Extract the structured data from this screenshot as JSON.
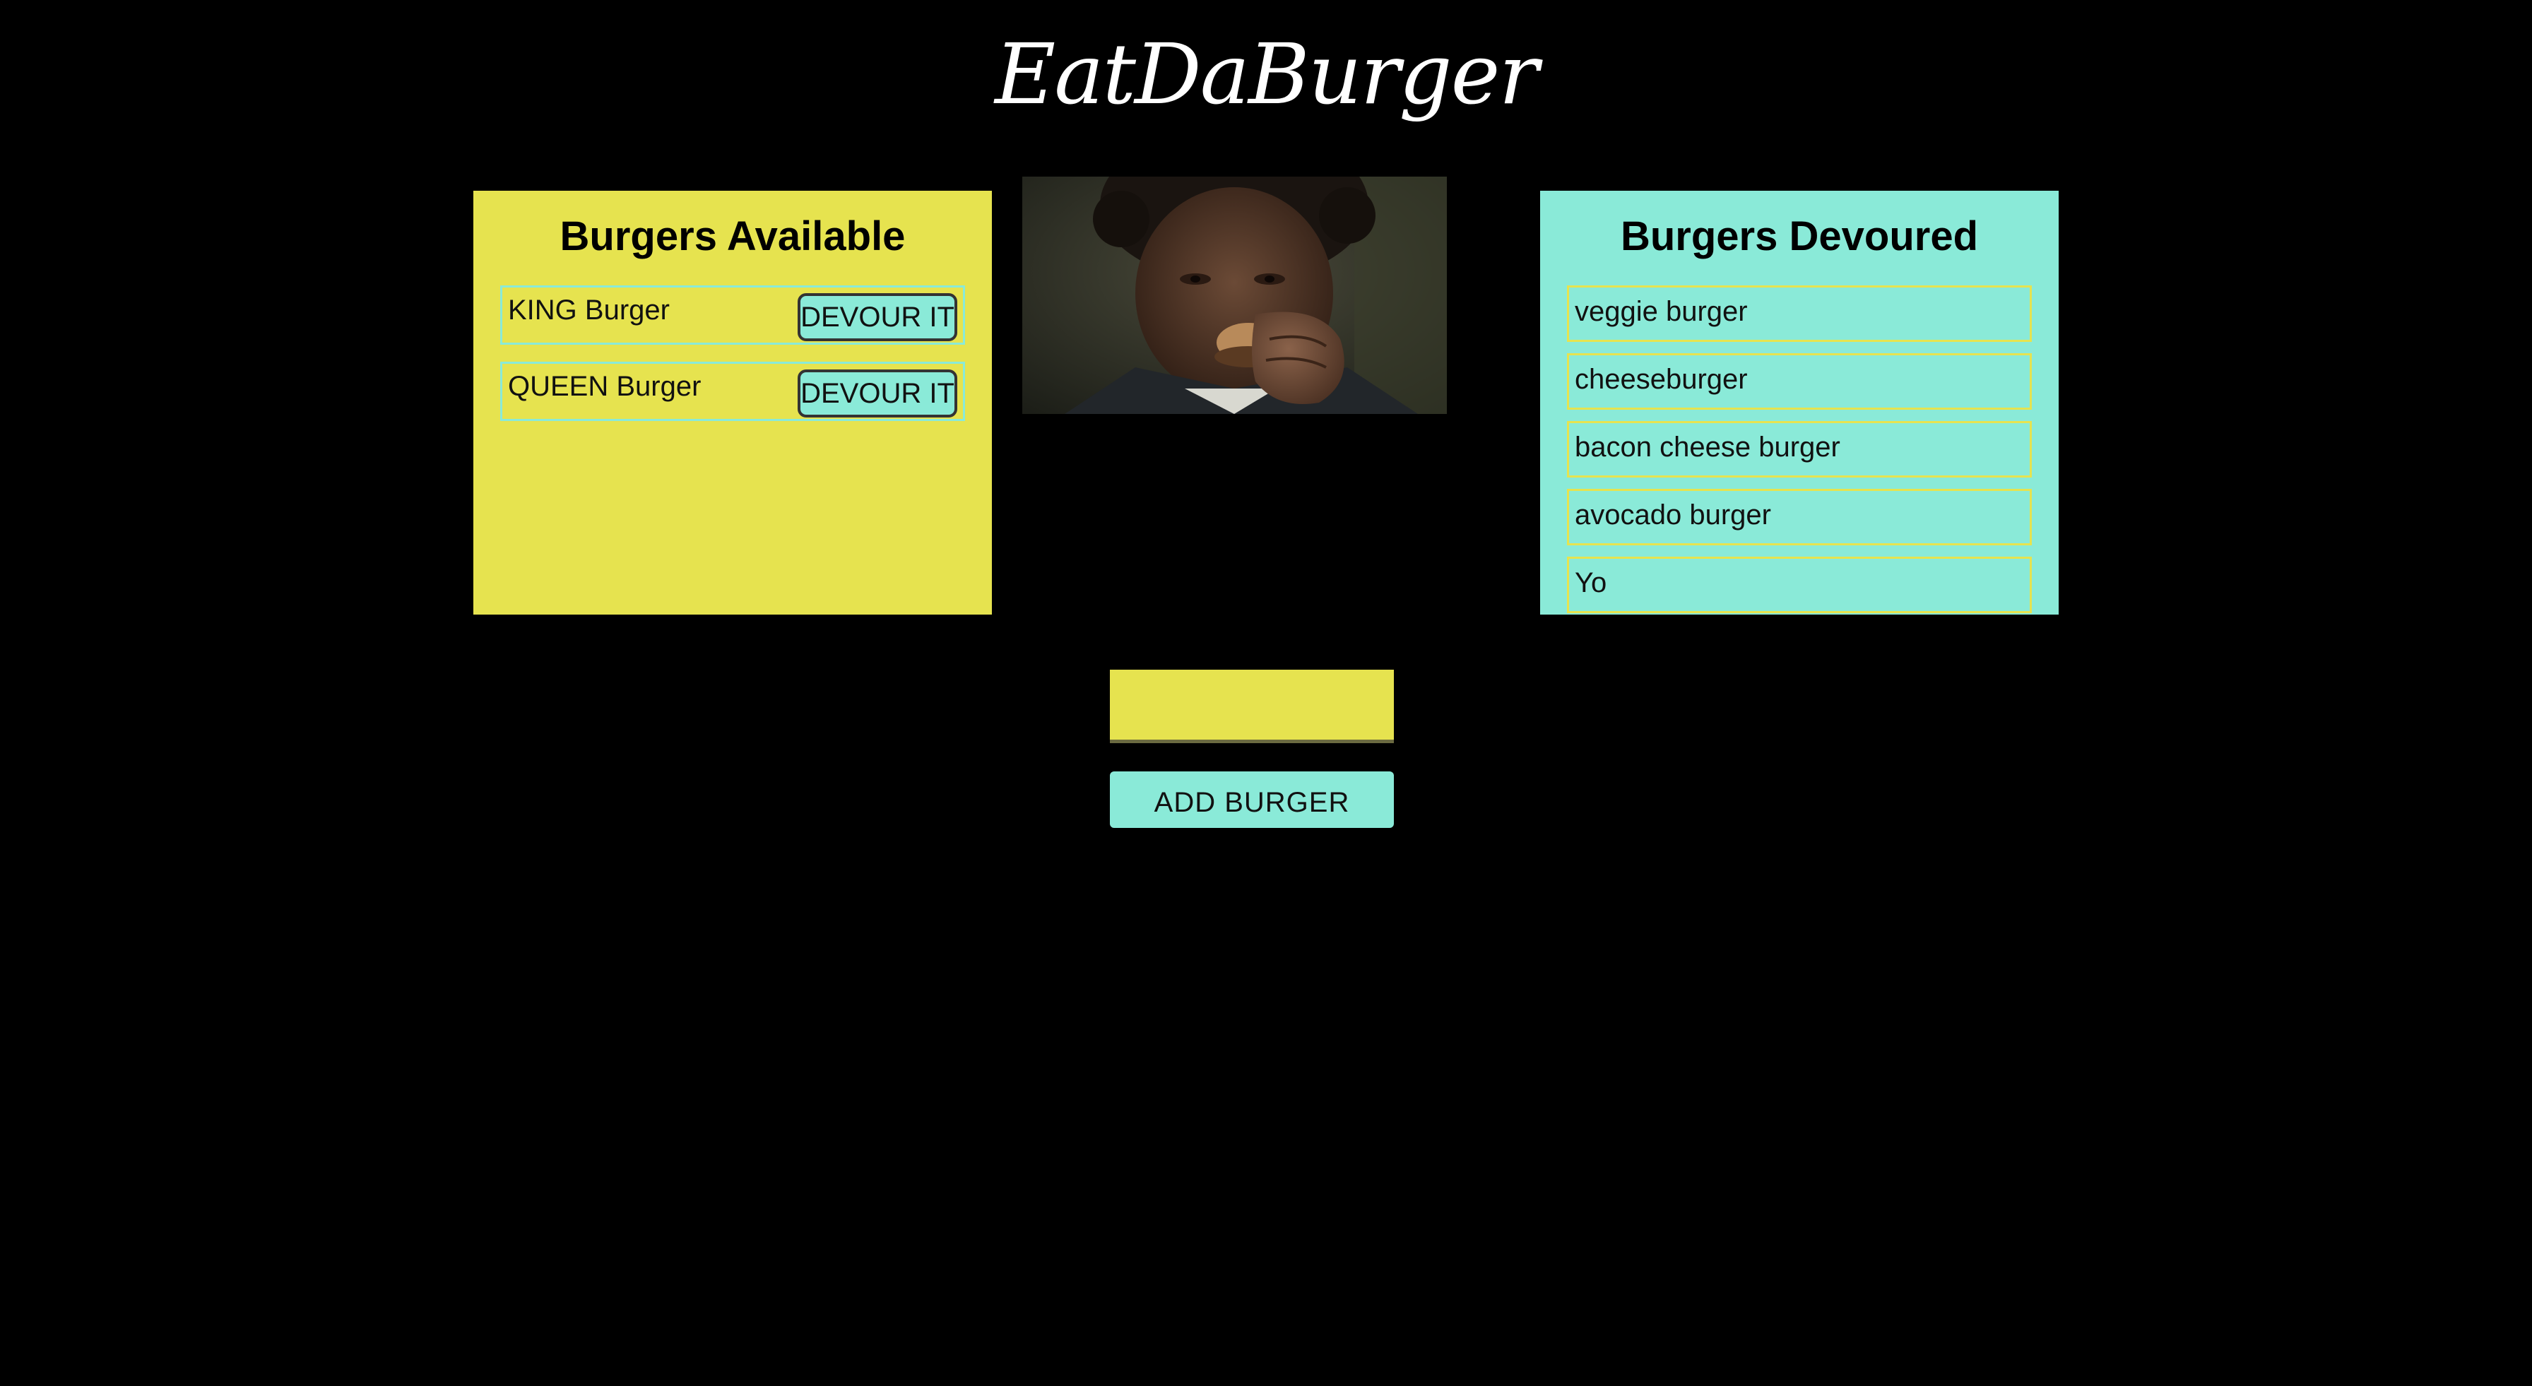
{
  "colors": {
    "background": "#000000",
    "yellow": "#e6e34f",
    "teal": "#8aead8",
    "title_text": "#ffffff"
  },
  "site": {
    "title": "EatDaBurger"
  },
  "available": {
    "heading": "Burgers Available",
    "items": [
      {
        "name": "KING Burger",
        "button_label": "DEVOUR IT"
      },
      {
        "name": "QUEEN Burger",
        "button_label": "DEVOUR IT"
      }
    ]
  },
  "devoured": {
    "heading": "Burgers Devoured",
    "items": [
      {
        "name": "veggie burger"
      },
      {
        "name": "cheeseburger"
      },
      {
        "name": "bacon cheese burger"
      },
      {
        "name": "avocado burger"
      },
      {
        "name": "Yo"
      }
    ]
  },
  "form": {
    "input_value": "",
    "input_placeholder": "",
    "add_button_label": "ADD BURGER"
  }
}
